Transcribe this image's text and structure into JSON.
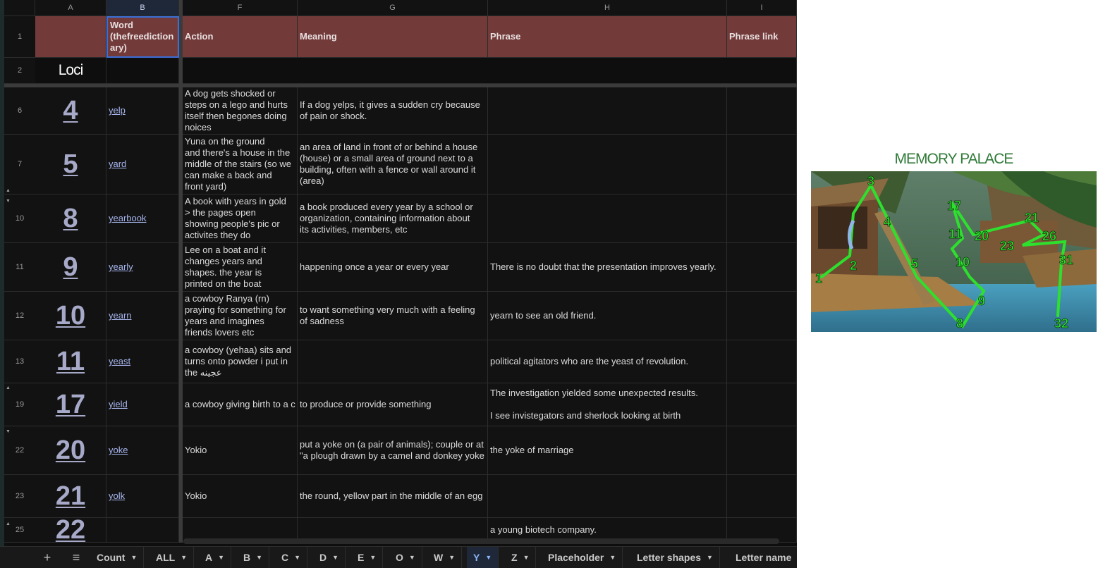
{
  "columns": [
    {
      "letter": "A"
    },
    {
      "letter": "B"
    },
    {
      "letter": "F"
    },
    {
      "letter": "G"
    },
    {
      "letter": "H"
    },
    {
      "letter": "I"
    }
  ],
  "header": {
    "row_number": "1",
    "word": "Word\n(thefreediction\nary)",
    "action": "Action",
    "meaning": "Meaning",
    "phrase": "Phrase",
    "phrase_link": "Phrase link"
  },
  "loci_row": {
    "row_number": "2",
    "label": "Loci"
  },
  "rows": [
    {
      "row": "6",
      "loci": "4",
      "word": "yelp",
      "action": "A dog gets shocked or\nsteps on a lego and hurts\nitself then begones doing\nnoices",
      "meaning": "If a dog yelps, it gives a sudden cry because\nof pain or shock.",
      "phrase": ""
    },
    {
      "row": "7",
      "loci": "5",
      "word": "yard",
      "action": "Yuna on the ground\nand there's a house in the\nmiddle of the stairs (so we\ncan make a back and\nfront yard)",
      "meaning": "an area of land in front of or behind a house\n(house) or a small area of ground next to a\nbuilding, often with a fence or wall around it\n(area)",
      "phrase": ""
    },
    {
      "row": "10",
      "loci": "8",
      "word": "yearbook",
      "action": "A book with years in gold\n> the pages open\nshowing people's pic or\nactivites they do",
      "meaning": "a book produced every year by a school or\norganization, containing information about\nits activities, members, etc",
      "phrase": ""
    },
    {
      "row": "11",
      "loci": "9",
      "word": "yearly",
      "action": "Lee on a boat and it\nchanges years and\nshapes. the year is\nprinted on the boat",
      "meaning": "happening once a year or every year",
      "phrase": "There is no doubt that the presentation improves yearly."
    },
    {
      "row": "12",
      "loci": "10",
      "word": "yearn",
      "action": "a cowboy Ranya (rn)\npraying for something for\nyears and imagines\nfriends lovers etc",
      "meaning": "to want something very much with a feeling\nof sadness",
      "phrase": "yearn to see an old friend."
    },
    {
      "row": "13",
      "loci": "11",
      "word": "yeast",
      "action": "a cowboy (yehaa) sits and\nturns onto powder i put in\nthe  عجينه",
      "meaning": "",
      "phrase": "political agitators who are the yeast of revolution."
    },
    {
      "row": "19",
      "loci": "17",
      "word": "yield",
      "action": "a cowboy giving birth to a c",
      "meaning": "to produce or provide something",
      "phrase": "The investigation yielded some unexpected results.\n\nI see invistegators and sherlock looking at birth"
    },
    {
      "row": "22",
      "loci": "20",
      "word": "yoke",
      "action": "Yokio",
      "meaning": "put a yoke on (a pair of animals); couple or at\n\"a plough drawn by a camel and donkey yoke",
      "phrase": "the yoke of marriage"
    },
    {
      "row": "23",
      "loci": "21",
      "word": "yolk",
      "action": "Yokio",
      "meaning": "the round, yellow part in the middle of an egg",
      "phrase": ""
    },
    {
      "row": "25",
      "loci": "22",
      "word": "",
      "action": "",
      "meaning": "",
      "phrase": "a young biotech company."
    }
  ],
  "tabs": [
    {
      "label": "Count"
    },
    {
      "label": "ALL"
    },
    {
      "label": "A"
    },
    {
      "label": "B"
    },
    {
      "label": "C"
    },
    {
      "label": "D"
    },
    {
      "label": "E"
    },
    {
      "label": "O"
    },
    {
      "label": "W"
    },
    {
      "label": "Y",
      "active": true
    },
    {
      "label": "Z"
    },
    {
      "label": "Placeholder"
    },
    {
      "label": "Letter shapes"
    },
    {
      "label": "Letter name"
    }
  ],
  "tab_controls": {
    "add": "+",
    "all_sheets": "≡"
  },
  "memory_palace": {
    "title": "MEMORY PALACE",
    "markers": [
      "1",
      "2",
      "3",
      "4",
      "5",
      "8",
      "9",
      "10",
      "11",
      "17",
      "20",
      "21",
      "23",
      "26",
      "31",
      "32"
    ],
    "colors": {
      "route": "#2ee02e",
      "sea": "#3f8fb0",
      "title": "#2f7a38"
    }
  }
}
